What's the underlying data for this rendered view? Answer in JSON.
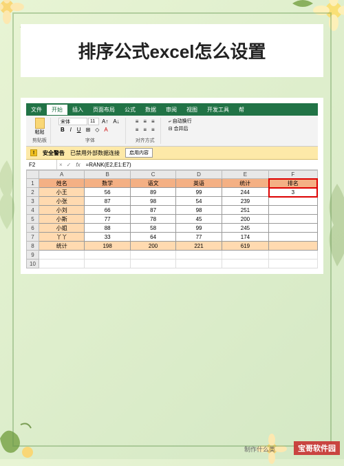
{
  "title": "排序公式excel怎么设置",
  "excel": {
    "tabs": [
      "文件",
      "开始",
      "插入",
      "页面布局",
      "公式",
      "数据",
      "审阅",
      "视图",
      "开发工具",
      "帮"
    ],
    "activeTab": 1,
    "paste_label": "粘贴",
    "clipboard_label": "剪贴板",
    "font_name": "宋体",
    "font_size": "11",
    "font_label": "字体",
    "align_label": "对齐方式",
    "wrap_label": "自动换行",
    "merge_label": "合并后",
    "warning": {
      "bold": "安全警告",
      "text": "已禁用外部数据连接",
      "button": "启用内容"
    },
    "cellRef": "F2",
    "formula": "=RANK(E2,E1:E7)",
    "columns": [
      "A",
      "B",
      "C",
      "D",
      "E",
      "F"
    ],
    "headers": [
      "姓名",
      "数学",
      "语文",
      "英语",
      "统计",
      "排名"
    ],
    "rows": [
      {
        "n": "1"
      },
      {
        "n": "2",
        "cells": [
          "小王",
          "56",
          "89",
          "99",
          "244",
          "3"
        ]
      },
      {
        "n": "3",
        "cells": [
          "小张",
          "87",
          "98",
          "54",
          "239",
          ""
        ]
      },
      {
        "n": "4",
        "cells": [
          "小刘",
          "66",
          "87",
          "98",
          "251",
          ""
        ]
      },
      {
        "n": "5",
        "cells": [
          "小斯",
          "77",
          "78",
          "45",
          "200",
          ""
        ]
      },
      {
        "n": "6",
        "cells": [
          "小姐",
          "88",
          "58",
          "99",
          "245",
          ""
        ]
      },
      {
        "n": "7",
        "cells": [
          "丫丫",
          "33",
          "64",
          "77",
          "174",
          ""
        ]
      },
      {
        "n": "8",
        "cells": [
          "统计",
          "198",
          "200",
          "221",
          "619",
          ""
        ]
      },
      {
        "n": "9"
      },
      {
        "n": "10"
      }
    ]
  },
  "watermark": "宝哥软件园",
  "footer": "制作什么类"
}
